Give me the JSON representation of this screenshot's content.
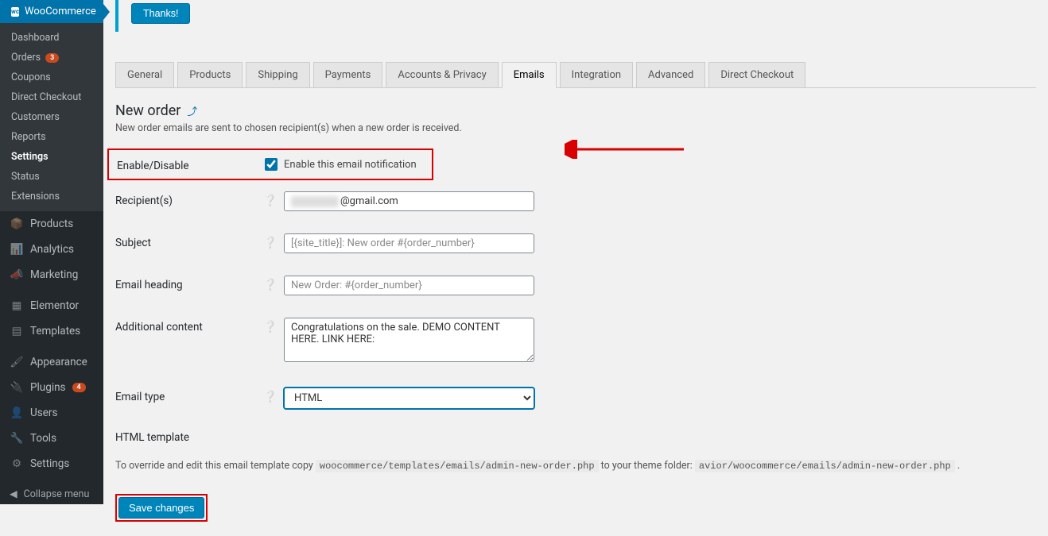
{
  "sidebar": {
    "woocommerce_label": "WooCommerce",
    "wc_sub": [
      {
        "label": "Dashboard"
      },
      {
        "label": "Orders",
        "badge": "3"
      },
      {
        "label": "Coupons"
      },
      {
        "label": "Direct Checkout"
      },
      {
        "label": "Customers"
      },
      {
        "label": "Reports"
      },
      {
        "label": "Settings",
        "active": true
      },
      {
        "label": "Status"
      },
      {
        "label": "Extensions"
      }
    ],
    "items": [
      {
        "icon": "📦",
        "label": "Products"
      },
      {
        "icon": "📊",
        "label": "Analytics"
      },
      {
        "icon": "📣",
        "label": "Marketing"
      },
      {
        "sep": true
      },
      {
        "icon": "▦",
        "label": "Elementor"
      },
      {
        "icon": "▤",
        "label": "Templates"
      },
      {
        "sep": true
      },
      {
        "icon": "🖌",
        "label": "Appearance"
      },
      {
        "icon": "🔌",
        "label": "Plugins",
        "badge": "4"
      },
      {
        "icon": "👤",
        "label": "Users"
      },
      {
        "icon": "🔧",
        "label": "Tools"
      },
      {
        "icon": "⚙",
        "label": "Settings"
      }
    ],
    "collapse_label": "Collapse menu"
  },
  "notice": {
    "thanks_label": "Thanks!"
  },
  "tabs": [
    "General",
    "Products",
    "Shipping",
    "Payments",
    "Accounts & Privacy",
    "Emails",
    "Integration",
    "Advanced",
    "Direct Checkout"
  ],
  "active_tab": "Emails",
  "page": {
    "title": "New order",
    "back_icon": "⤴",
    "description": "New order emails are sent to chosen recipient(s) when a new order is received."
  },
  "form": {
    "enable_label": "Enable/Disable",
    "enable_checkbox_label": "Enable this email notification",
    "enable_checked": true,
    "recipients_label": "Recipient(s)",
    "recipients_suffix": "@gmail.com",
    "subject_label": "Subject",
    "subject_placeholder": "[{site_title}]: New order #{order_number}",
    "subject_value": "",
    "heading_label": "Email heading",
    "heading_placeholder": "New Order: #{order_number}",
    "heading_value": "",
    "additional_label": "Additional content",
    "additional_value": "Congratulations on the sale. DEMO CONTENT HERE. LINK HERE:",
    "type_label": "Email type",
    "type_value": "HTML",
    "help_icon": "❔"
  },
  "template": {
    "title": "HTML template",
    "desc_prefix": "To override and edit this email template copy ",
    "code1": "woocommerce/templates/emails/admin-new-order.php",
    "desc_mid": " to your theme folder: ",
    "code2": "avior/woocommerce/emails/admin-new-order.php",
    "desc_suffix": " ."
  },
  "save_label": "Save changes"
}
